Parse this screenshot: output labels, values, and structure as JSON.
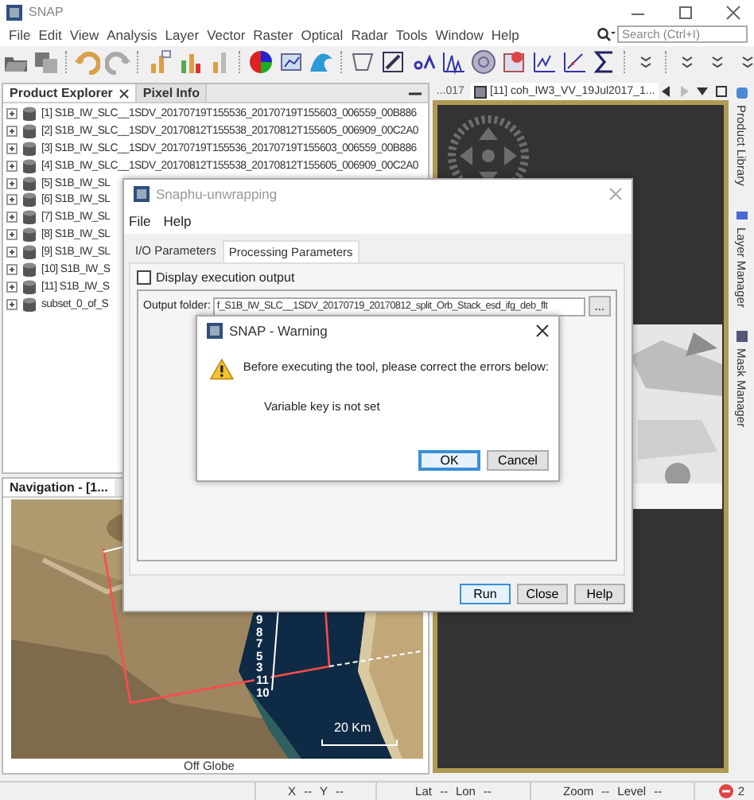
{
  "window": {
    "title": "SNAP"
  },
  "menu": [
    "File",
    "Edit",
    "View",
    "Analysis",
    "Layer",
    "Vector",
    "Raster",
    "Optical",
    "Radar",
    "Tools",
    "Window",
    "Help"
  ],
  "search": {
    "placeholder": "Search (Ctrl+I)"
  },
  "product_explorer": {
    "tabs": [
      {
        "label": "Product Explorer",
        "selected": true,
        "closable": true
      },
      {
        "label": "Pixel Info",
        "selected": false,
        "closable": false
      }
    ],
    "products": [
      "[1] S1B_IW_SLC__1SDV_20170719T155536_20170719T155603_006559_00B886",
      "[2] S1B_IW_SLC__1SDV_20170812T155538_20170812T155605_006909_00C2A0",
      "[3] S1B_IW_SLC__1SDV_20170719T155536_20170719T155603_006559_00B886",
      "[4] S1B_IW_SLC__1SDV_20170812T155538_20170812T155605_006909_00C2A0",
      "[5] S1B_IW_SL",
      "[6] S1B_IW_SL",
      "[7] S1B_IW_SL",
      "[8] S1B_IW_SL",
      "[9] S1B_IW_SL",
      "[10] S1B_IW_S",
      "[11] S1B_IW_S",
      "subset_0_of_S"
    ]
  },
  "navigation": {
    "title": "Navigation - [1...",
    "footprint_labels": [
      "9",
      "8",
      "7",
      "5",
      "3",
      "11",
      "10"
    ],
    "scale": "20 Km",
    "caption": "Off Globe"
  },
  "image_view": {
    "tabs": [
      {
        "label": "...017",
        "selected": false
      },
      {
        "label": "[11] coh_IW3_VV_19Jul2017_1...",
        "selected": true
      }
    ]
  },
  "side_tabs": [
    "Product Library",
    "Layer Manager",
    "Mask Manager"
  ],
  "status_bar": {
    "groups": [
      [
        {
          "label": "X",
          "value": "--"
        },
        {
          "label": "Y",
          "value": "--"
        }
      ],
      [
        {
          "label": "Lat",
          "value": "--"
        },
        {
          "label": "Lon",
          "value": "--"
        }
      ],
      [
        {
          "label": "Zoom",
          "value": "--"
        },
        {
          "label": "Level",
          "value": "--"
        }
      ]
    ],
    "error_count": "2"
  },
  "snaphu_dialog": {
    "title": "Snaphu-unwrapping",
    "menu": [
      "File",
      "Help"
    ],
    "tabs": [
      {
        "label": "I/O Parameters",
        "selected": false
      },
      {
        "label": "Processing Parameters",
        "selected": true
      }
    ],
    "display_output": {
      "label": "Display execution output",
      "checked": false
    },
    "output_folder": {
      "label": "Output folder:",
      "value": "f_S1B_IW_SLC__1SDV_20170719_20170812_split_Orb_Stack_esd_ifg_deb_flt"
    },
    "browse": "...",
    "buttons": [
      {
        "label": "Run",
        "default": true
      },
      {
        "label": "Close",
        "default": false
      },
      {
        "label": "Help",
        "default": false
      }
    ]
  },
  "warning_dialog": {
    "title": "SNAP - Warning",
    "message": "Before executing the tool, please correct the errors below:",
    "error": "Variable key is not set",
    "buttons": [
      {
        "label": "OK",
        "default": true
      },
      {
        "label": "Cancel",
        "default": false
      }
    ]
  }
}
